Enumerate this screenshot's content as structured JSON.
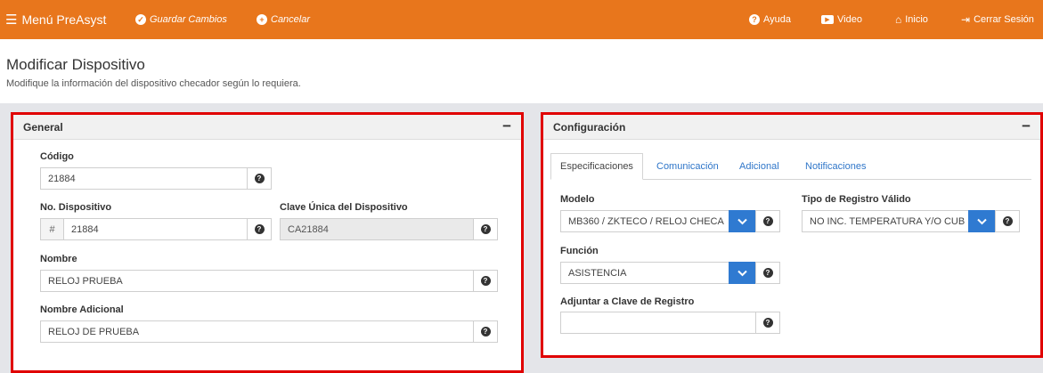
{
  "topbar": {
    "menu_label": "Menú PreAsyst",
    "save_label": "Guardar Cambios",
    "cancel_label": "Cancelar",
    "help_label": "Ayuda",
    "video_label": "Video",
    "home_label": "Inicio",
    "logout_label": "Cerrar Sesión"
  },
  "header": {
    "title": "Modificar Dispositivo",
    "subtitle": "Modifique la información del dispositivo checador según lo requiera."
  },
  "general": {
    "title": "General",
    "collapse_symbol": "−",
    "codigo_label": "Código",
    "codigo_value": "21884",
    "no_dispositivo_label": "No. Dispositivo",
    "no_dispositivo_prefix": "#",
    "no_dispositivo_value": "21884",
    "clave_unica_label": "Clave Única del Dispositivo",
    "clave_unica_value": "CA21884",
    "nombre_label": "Nombre",
    "nombre_value": "RELOJ PRUEBA",
    "nombre_adicional_label": "Nombre Adicional",
    "nombre_adicional_value": "RELOJ DE PRUEBA"
  },
  "config": {
    "title": "Configuración",
    "collapse_symbol": "−",
    "tabs": [
      "Especificaciones",
      "Comunicación",
      "Adicional",
      "Notificaciones"
    ],
    "modelo_label": "Modelo",
    "modelo_value": "MB360 / ZKTECO / RELOJ CHECA",
    "tipo_registro_label": "Tipo de Registro Válido",
    "tipo_registro_value": "NO INC. TEMPERATURA Y/O CUB",
    "funcion_label": "Función",
    "funcion_value": "ASISTENCIA",
    "adjuntar_label": "Adjuntar a Clave de Registro",
    "adjuntar_value": ""
  },
  "colors": {
    "topbar": "#e8761c",
    "highlight_border": "#e00000",
    "link": "#2f76c9",
    "dropdown_button": "#2f7ad1"
  }
}
